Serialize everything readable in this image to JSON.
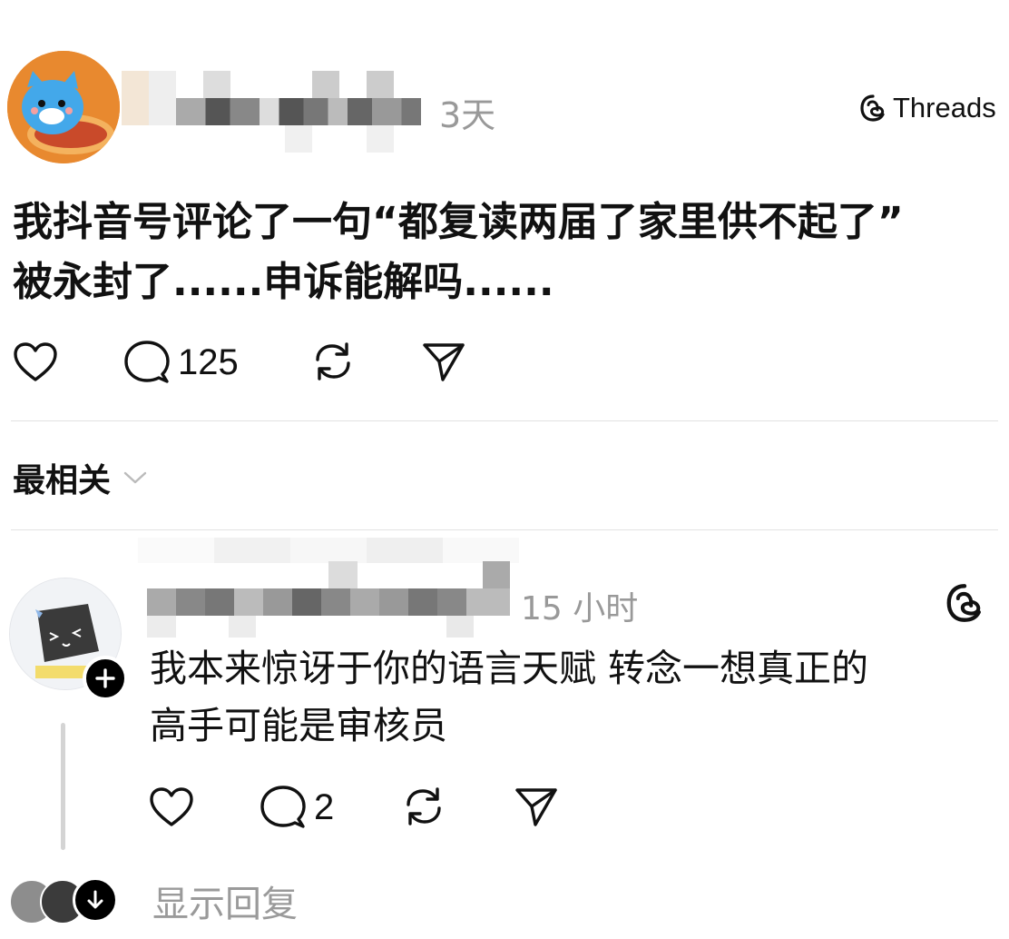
{
  "post": {
    "time": "3天",
    "brand": "Threads",
    "text_line1": "我抖音号评论了一句“都复读两届了家里供不起了”",
    "text_line2": "被永封了......申诉能解吗......",
    "reply_count": "125"
  },
  "sort": {
    "label": "最相关"
  },
  "reply": {
    "time": "15 小时",
    "text_line1": "我本来惊讶于你的语言天赋 转念一想真正的",
    "text_line2": "高手可能是审核员",
    "reply_count": "2",
    "show_replies": "显示回复"
  },
  "colors": {
    "avatar_orange": "#e8892f",
    "muted_gray": "#999999",
    "divider": "#e2e2e2"
  },
  "icons": [
    "heart-icon",
    "comment-icon",
    "repost-icon",
    "share-icon",
    "threads-logo-icon",
    "chevron-down-icon",
    "follow-plus-icon"
  ]
}
